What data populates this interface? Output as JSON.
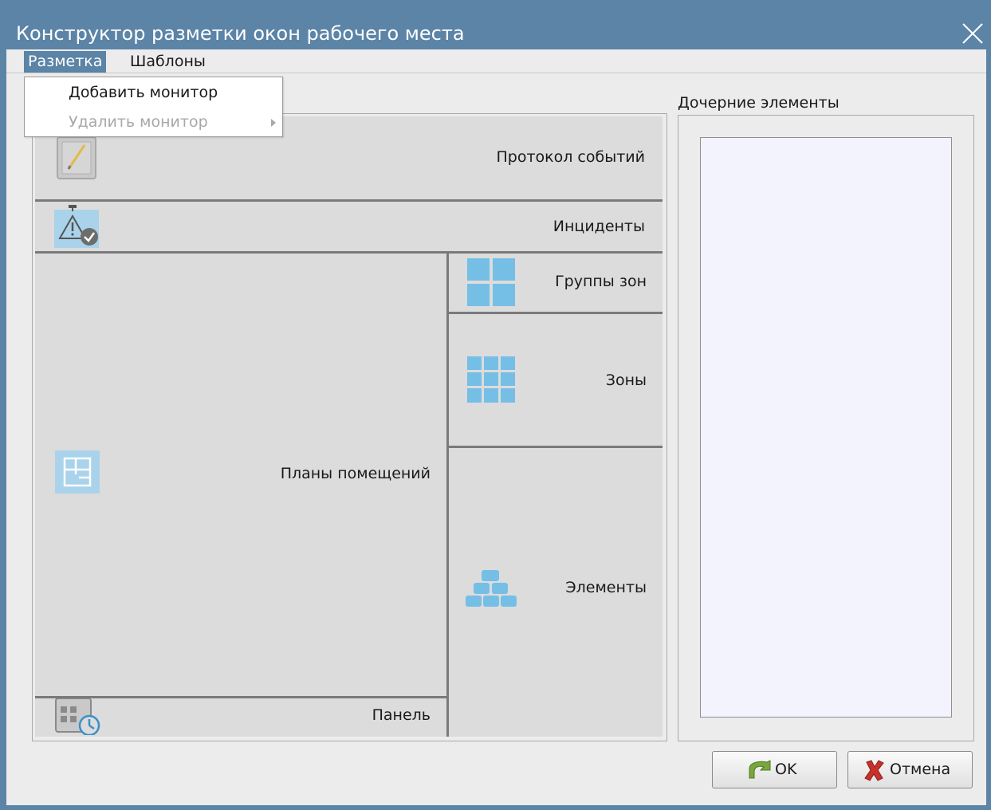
{
  "window": {
    "title": "Конструктор разметки окон рабочего места",
    "accent_color": "#5b84a6"
  },
  "menubar": {
    "items": [
      {
        "label": "Разметка",
        "active": true
      },
      {
        "label": "Шаблоны",
        "active": false
      }
    ]
  },
  "dropdown": {
    "items": [
      {
        "label": "Добавить монитор",
        "enabled": true
      },
      {
        "label": "Удалить монитор",
        "enabled": false,
        "has_submenu": true
      }
    ]
  },
  "layout": {
    "panes": {
      "journal": {
        "label": "Протокол событий",
        "icon": "journal-icon"
      },
      "incidents": {
        "label": "Инциденты",
        "icon": "incidents-icon"
      },
      "zone_groups": {
        "label": "Группы зон",
        "icon": "zone-groups-icon"
      },
      "zones": {
        "label": "Зоны",
        "icon": "zones-icon"
      },
      "plans": {
        "label": "Планы помещений",
        "icon": "floor-plans-icon"
      },
      "devices": {
        "label": "Элементы",
        "icon": "elements-icon"
      },
      "panel": {
        "label": "Панель",
        "icon": "panel-icon"
      }
    }
  },
  "children": {
    "title": "Дочерние элементы",
    "items": []
  },
  "buttons": {
    "ok": "OK",
    "cancel": "Отмена"
  }
}
